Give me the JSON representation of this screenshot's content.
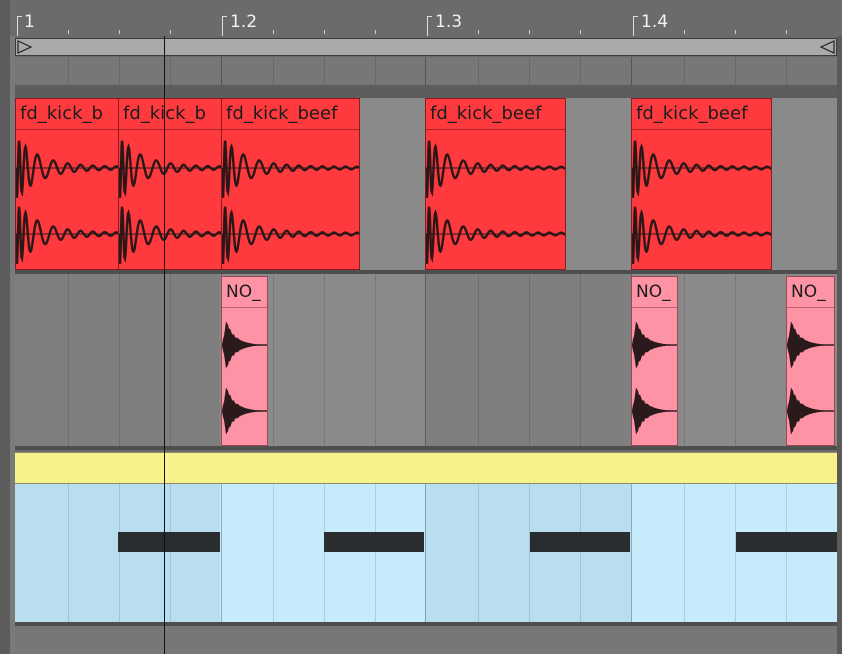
{
  "ruler": {
    "bars": [
      "1",
      "1.2",
      "1.3",
      "1.4"
    ]
  },
  "tracks": {
    "kick": {
      "clips": [
        {
          "name": "fd_kick_b"
        },
        {
          "name": "fd_kick_b"
        },
        {
          "name": "fd_kick_beef"
        },
        {
          "name": "fd_kick_beef"
        },
        {
          "name": "fd_kick_beef"
        }
      ]
    },
    "noise": {
      "clips": [
        {
          "name": "NO_"
        },
        {
          "name": "NO_"
        },
        {
          "name": "NO_"
        }
      ]
    }
  },
  "colors": {
    "kick_clip": "#ff3a3f",
    "noise_clip": "#ff93a6",
    "midi_header": "#f7f28a",
    "midi_body": "#c6ecfb",
    "note": "#2a2d2f"
  }
}
